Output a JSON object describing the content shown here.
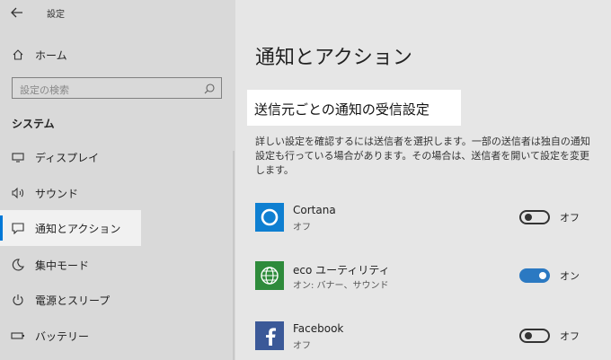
{
  "window": {
    "title": "設定"
  },
  "sidebar": {
    "home_label": "ホーム",
    "search_placeholder": "設定の検索",
    "section_label": "システム",
    "items": [
      {
        "label": "ディスプレイ"
      },
      {
        "label": "サウンド"
      },
      {
        "label": "通知とアクション"
      },
      {
        "label": "集中モード"
      },
      {
        "label": "電源とスリープ"
      },
      {
        "label": "バッテリー"
      }
    ]
  },
  "main": {
    "page_title": "通知とアクション",
    "section_heading": "送信元ごとの通知の受信設定",
    "description": "詳しい設定を確認するには送信者を選択します。一部の送信者は独自の通知設定も行っている場合があります。その場合は、送信者を開いて設定を変更します。",
    "apps": [
      {
        "name": "Cortana",
        "sub": "オフ",
        "toggle": "オフ",
        "on": false
      },
      {
        "name": "eco ユーティリティ",
        "sub": "オン: バナー、サウンド",
        "toggle": "オン",
        "on": true
      },
      {
        "name": "Facebook",
        "sub": "オフ",
        "toggle": "オフ",
        "on": false
      }
    ]
  },
  "colors": {
    "accent": "#0078d7",
    "toggle_on": "#2b79c2",
    "cortana": "#0e7fd1",
    "eco": "#2e8b3b",
    "facebook": "#3b5998"
  }
}
